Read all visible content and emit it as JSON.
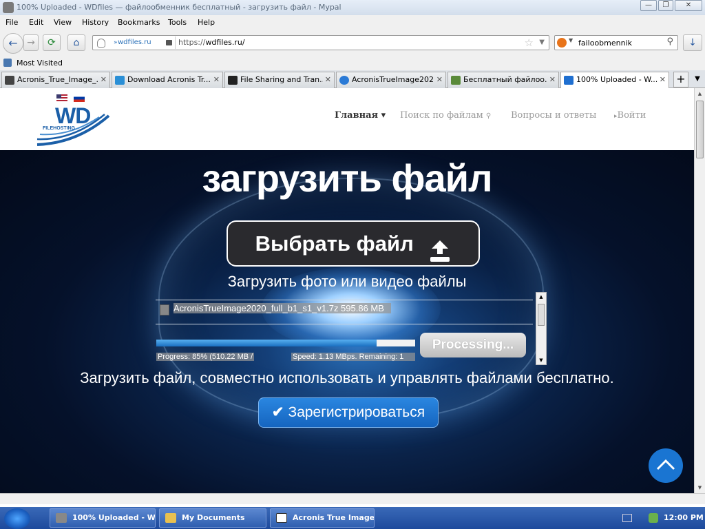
{
  "window": {
    "title": "100% Uploaded - WDfiles — файлообменник бесплатный - загрузить файл - Mypal",
    "minimize": "—",
    "maximize": "❐",
    "close": "✕"
  },
  "menu": [
    "File",
    "Edit",
    "View",
    "History",
    "Bookmarks",
    "Tools",
    "Help"
  ],
  "navbar": {
    "identity": "wdfiles.ru",
    "url_scheme": "https://",
    "url_host": "wdfiles.ru/",
    "search_value": "failoobmennik"
  },
  "bookmarks": {
    "most_visited": "Most Visited"
  },
  "tabs": [
    {
      "label": "Acronis_True_Image_...",
      "favicon_color": "#444444"
    },
    {
      "label": "Download Acronis Tr...",
      "favicon_color": "#2a8fd6"
    },
    {
      "label": "File Sharing and Tran...",
      "favicon_color": "#222222"
    },
    {
      "label": "AcronisTrueImage202...",
      "favicon_color": "#2a7ad6"
    },
    {
      "label": "Бесплатный файлоо...",
      "favicon_color": "#5a8a3a"
    },
    {
      "label": "100% Uploaded - W...",
      "favicon_color": "#1f6fd0",
      "active": true
    }
  ],
  "site": {
    "logo_text": "WD",
    "logo_sub": "FILEHOSTING",
    "nav": {
      "home": "Главная ▾",
      "search": "Поиск по файлам",
      "faq": "Вопросы и ответы",
      "login": "Войти"
    }
  },
  "hero": {
    "title": "загрузить файл",
    "choose_button": "Выбрать файл",
    "subtitle": "Загрузить фото или видео файлы",
    "file_name": "AcronisTrueImage2020_full_b1_s1_v1.7z  595.86 MB",
    "progress_fraction": 0.85,
    "progress_text": "Progress: 85% (510.22 MB /",
    "speed_text": "Speed: 1.13 MBps. Remaining: 1",
    "processing_button": "Processing...",
    "tagline": "Загрузить файл, совместно использовать и управлять файлами бесплатно.",
    "register_button": "Зарегистрироваться"
  },
  "taskbar": {
    "tasks": [
      {
        "label": "100% Uploaded - W...",
        "icon_color": "#888888"
      },
      {
        "label": "My Documents",
        "icon_color": "#e8c050"
      },
      {
        "label": "Acronis True Image ...",
        "icon_color": "#ffffff"
      }
    ],
    "clock": "12:00 PM"
  },
  "colors": {
    "accent": "#1a75d2",
    "hero_bg": "#05112a",
    "button_dark": "#2a2a2e"
  }
}
